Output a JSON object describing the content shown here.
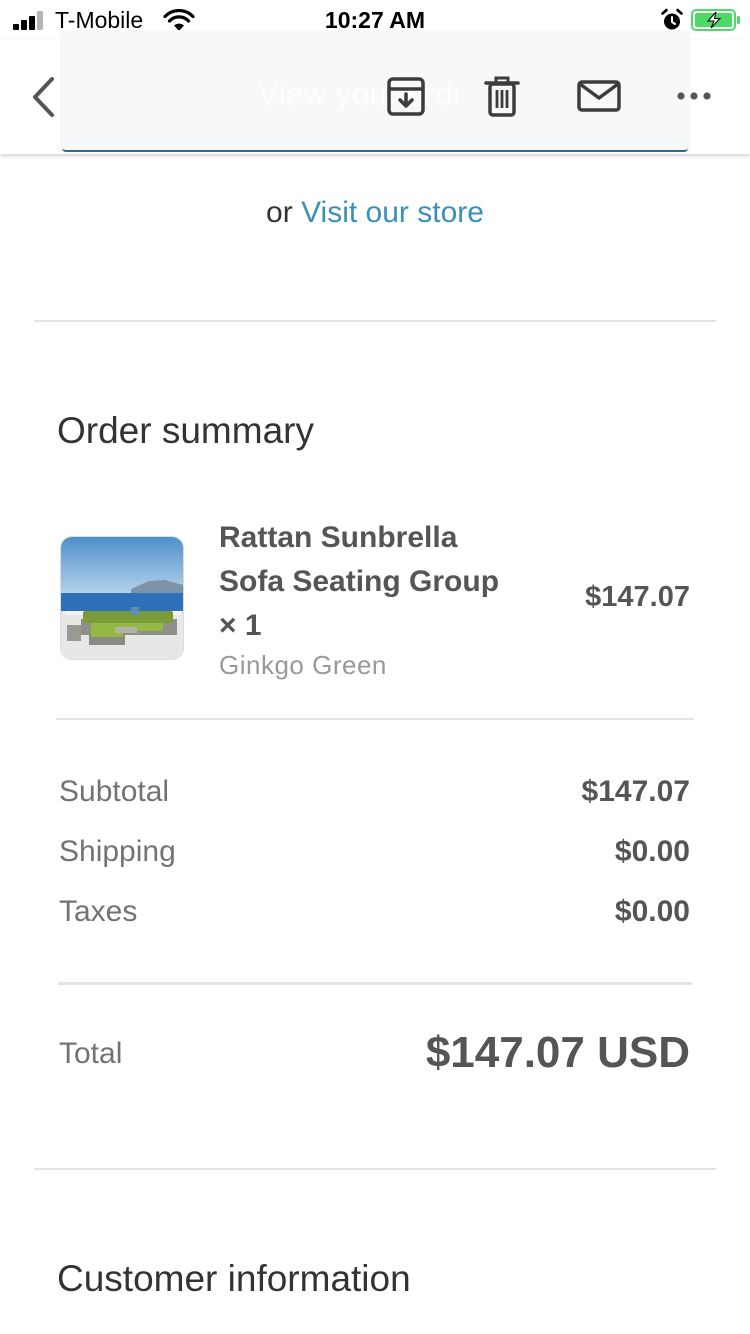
{
  "status_bar": {
    "carrier": "T-Mobile",
    "time": "10:27 AM",
    "signal_bars_filled": 3,
    "signal_bars_total": 4,
    "battery_state": "charging"
  },
  "nav": {
    "back_icon": "chevron-left-icon",
    "ghost_button_label": "View your order",
    "archive_icon": "archive-icon",
    "trash_icon": "trash-icon",
    "mail_icon": "mail-icon",
    "more_icon": "more-horizontal-icon"
  },
  "store": {
    "prefix": "or",
    "link": "Visit our store"
  },
  "order_summary": {
    "title": "Order summary",
    "item": {
      "name": "Rattan Sunbrella Sofa Seating Group × 1",
      "variant": "Ginkgo Green",
      "price": "$147.07"
    },
    "lines": [
      {
        "label": "Subtotal",
        "value": "$147.07"
      },
      {
        "label": "Shipping",
        "value": "$0.00"
      },
      {
        "label": "Taxes",
        "value": "$0.00"
      }
    ],
    "total": {
      "label": "Total",
      "value": "$147.07 USD"
    }
  },
  "customer_information": {
    "title": "Customer information"
  },
  "colors": {
    "link": "#3b8fb9",
    "battery": "#4cd964",
    "nav_overlay_border": "#2e6a86",
    "divider": "#e3e3e3"
  }
}
